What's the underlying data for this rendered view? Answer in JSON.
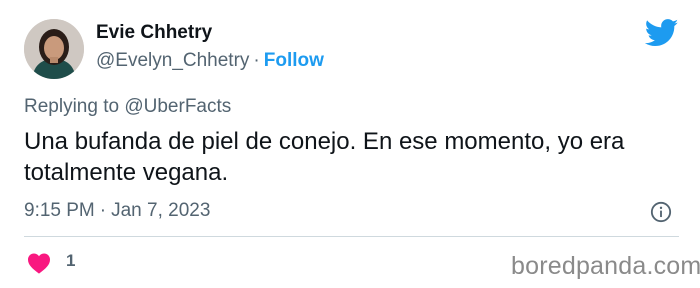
{
  "author": {
    "name": "Evie Chhetry",
    "handle": "@Evelyn_Chhetry",
    "separator": "·",
    "follow_label": "Follow"
  },
  "reply": {
    "prefix": "Replying to",
    "mention": "@UberFacts"
  },
  "tweet": {
    "text": "Una bufanda de piel de conejo. En ese momento, yo era totalmente vegana."
  },
  "meta": {
    "time": "9:15 PM",
    "separator": "·",
    "date": "Jan 7, 2023"
  },
  "engagement": {
    "likes": "1"
  },
  "icons": {
    "brand": "twitter-bird-icon",
    "info": "info-icon",
    "like": "heart-icon"
  },
  "colors": {
    "accent": "#1d9bf0",
    "like": "#f91880",
    "secondary_text": "#536471"
  },
  "watermark": "boredpanda.com"
}
